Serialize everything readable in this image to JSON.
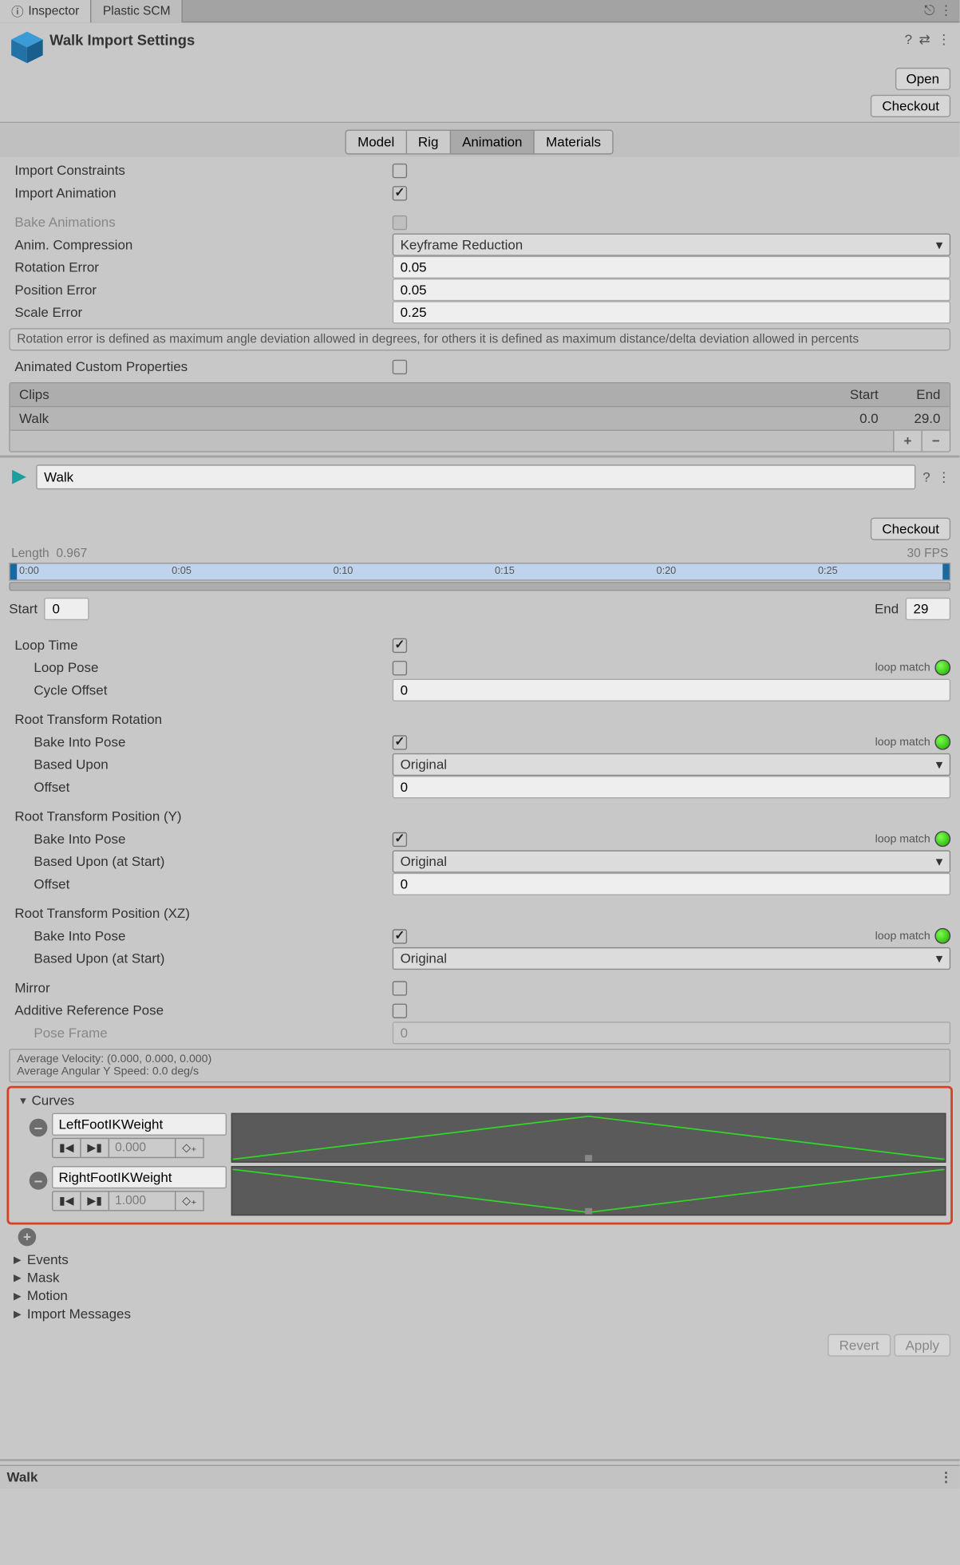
{
  "tabs": {
    "inspector": "Inspector",
    "plastic": "Plastic SCM"
  },
  "header": {
    "title": "Walk Import Settings",
    "open": "Open",
    "checkout": "Checkout"
  },
  "importTabs": {
    "model": "Model",
    "rig": "Rig",
    "animation": "Animation",
    "materials": "Materials"
  },
  "fields": {
    "importConstraints": "Import Constraints",
    "importAnimation": "Import Animation",
    "bakeAnimations": "Bake Animations",
    "animCompression": "Anim. Compression",
    "animCompressionVal": "Keyframe Reduction",
    "rotationError": "Rotation Error",
    "rotationErrorVal": "0.05",
    "positionError": "Position Error",
    "positionErrorVal": "0.05",
    "scaleError": "Scale Error",
    "scaleErrorVal": "0.25",
    "errorHelp": "Rotation error is defined as maximum angle deviation allowed in degrees, for others it is defined as maximum distance/delta deviation allowed in percents",
    "animatedCustom": "Animated Custom Properties"
  },
  "clips": {
    "header": "Clips",
    "start": "Start",
    "end": "End",
    "name": "Walk",
    "startVal": "0.0",
    "endVal": "29.0"
  },
  "clip": {
    "name": "Walk",
    "checkout": "Checkout",
    "length": "Length",
    "lengthVal": "0.967",
    "fps": "30 FPS",
    "t0": "0:00",
    "t5": "0:05",
    "t10": "0:10",
    "t15": "0:15",
    "t20": "0:20",
    "t25": "0:25",
    "start": "Start",
    "startVal": "0",
    "end": "End",
    "endVal": "29",
    "loopTime": "Loop Time",
    "loopPose": "Loop Pose",
    "loopMatch": "loop match",
    "cycleOffset": "Cycle Offset",
    "cycleOffsetVal": "0",
    "rtr": "Root Transform Rotation",
    "bakeIntoPose": "Bake Into Pose",
    "basedUpon": "Based Upon",
    "basedUponStart": "Based Upon (at Start)",
    "original": "Original",
    "offset": "Offset",
    "offsetVal": "0",
    "rty": "Root Transform Position (Y)",
    "rtxz": "Root Transform Position (XZ)",
    "mirror": "Mirror",
    "addRef": "Additive Reference Pose",
    "poseFrame": "Pose Frame",
    "poseFrameVal": "0",
    "stats1": "Average Velocity: (0.000, 0.000, 0.000)",
    "stats2": "Average Angular Y Speed: 0.0 deg/s"
  },
  "curves": {
    "title": "Curves",
    "left": "LeftFootIKWeight",
    "leftVal": "0.000",
    "right": "RightFootIKWeight",
    "rightVal": "1.000"
  },
  "foldouts": {
    "events": "Events",
    "mask": "Mask",
    "motion": "Motion",
    "importMsg": "Import Messages"
  },
  "actions": {
    "revert": "Revert",
    "apply": "Apply"
  },
  "footer": {
    "name": "Walk"
  }
}
